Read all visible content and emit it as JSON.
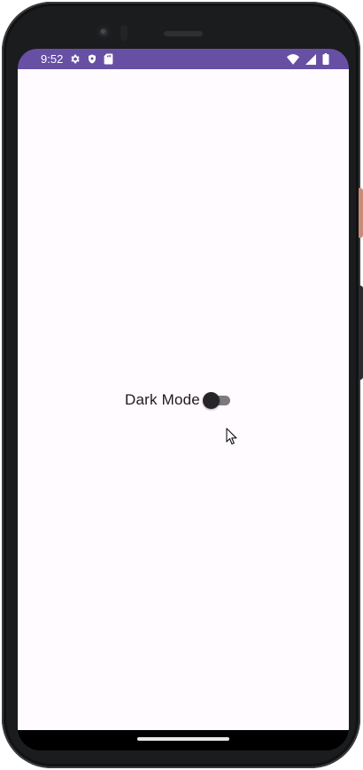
{
  "status_bar": {
    "time": "9:52",
    "background": "#6750a4",
    "left_icons": [
      "gear-icon",
      "shield-icon",
      "sd-card-icon"
    ],
    "right_icons": [
      "wifi-icon",
      "cellular-signal-icon",
      "battery-icon"
    ]
  },
  "main": {
    "background": "#fffbfe",
    "setting": {
      "label": "Dark Mode",
      "toggle_checked": false
    }
  },
  "device": {
    "frame_color": "#1b1c1e",
    "power_button_color": "#c98a76"
  }
}
